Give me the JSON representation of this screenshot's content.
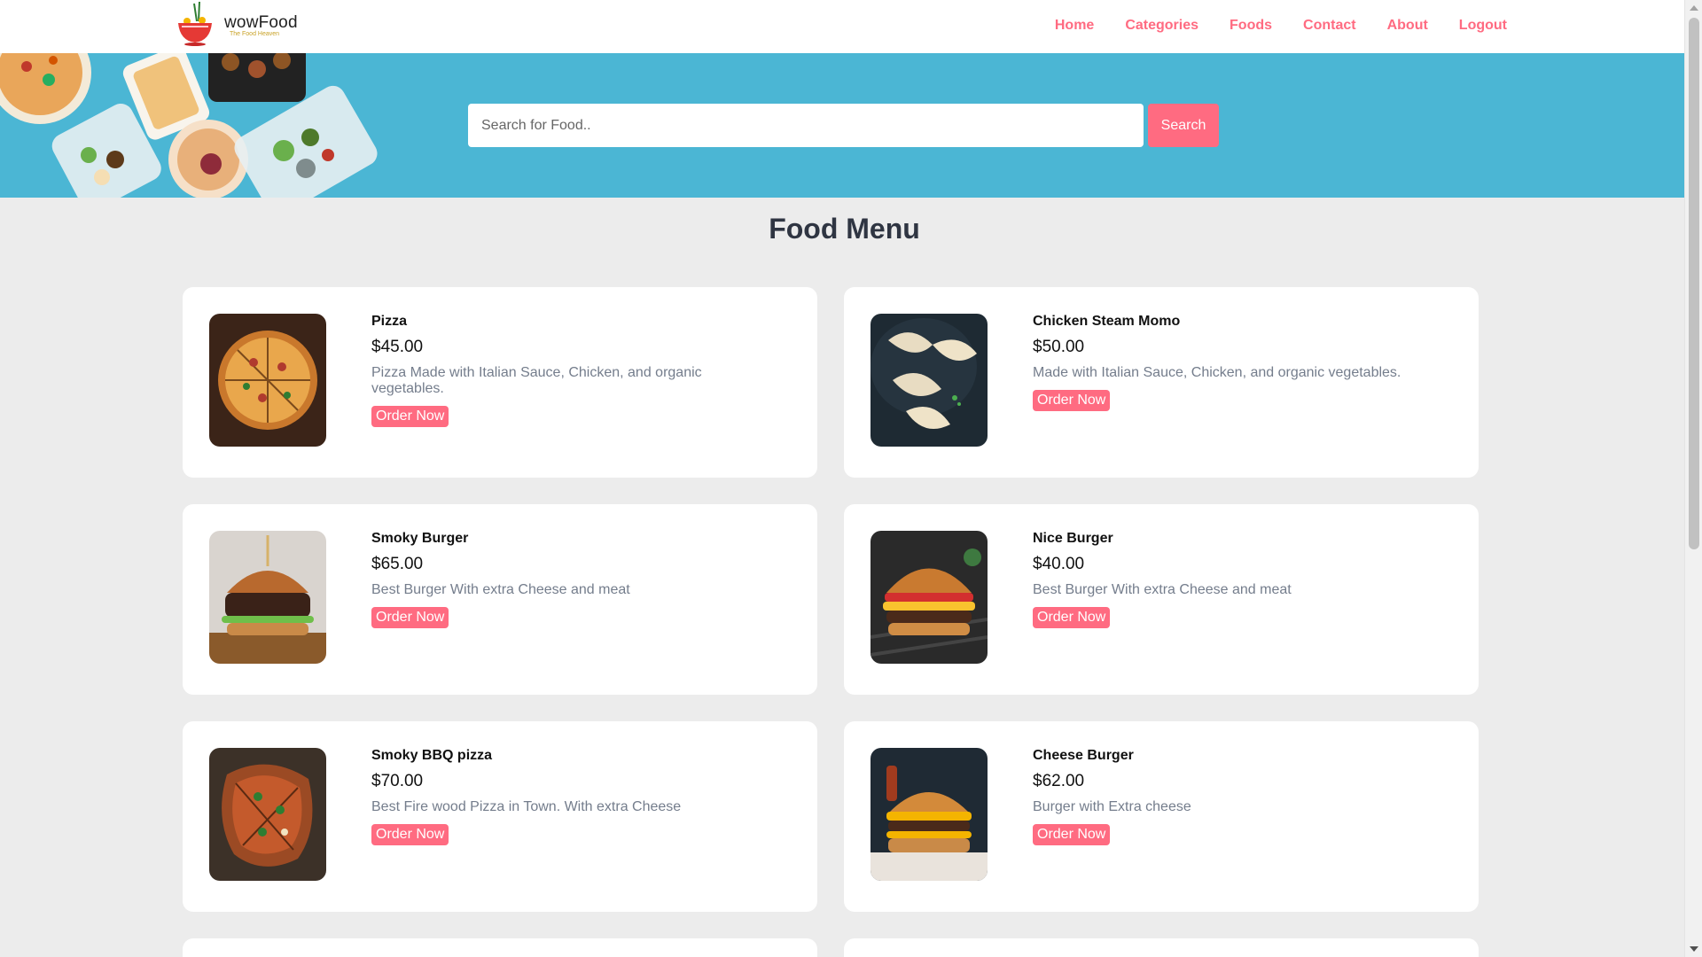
{
  "brand": {
    "name": "wowFood",
    "tagline": "The Food Heaven"
  },
  "nav": [
    "Home",
    "Categories",
    "Foods",
    "Contact",
    "About",
    "Logout"
  ],
  "search": {
    "placeholder": "Search for Food..",
    "button_label": "Search"
  },
  "menu": {
    "title": "Food Menu",
    "items": [
      {
        "name": "Pizza",
        "price": "$45.00",
        "description": "Pizza Made with Italian Sauce, Chicken, and organic vegetables.",
        "order_label": "Order Now",
        "image": "pizza"
      },
      {
        "name": "Chicken Steam Momo",
        "price": "$50.00",
        "description": "Made with Italian Sauce, Chicken, and organic vegetables.",
        "order_label": "Order Now",
        "image": "momo"
      },
      {
        "name": "Smoky Burger",
        "price": "$65.00",
        "description": "Best Burger With extra Cheese and meat",
        "order_label": "Order Now",
        "image": "burger"
      },
      {
        "name": "Nice Burger",
        "price": "$40.00",
        "description": "Best Burger With extra Cheese and meat",
        "order_label": "Order Now",
        "image": "burger"
      },
      {
        "name": "Smoky BBQ pizza",
        "price": "$70.00",
        "description": "Best Fire wood Pizza in Town. With extra Cheese",
        "order_label": "Order Now",
        "image": "pizza"
      },
      {
        "name": "Cheese Burger",
        "price": "$62.00",
        "description": "Burger with Extra cheese",
        "order_label": "Order Now",
        "image": "burger"
      }
    ]
  },
  "colors": {
    "accent": "#ff6b81",
    "hero": "#4bb6d4",
    "heading": "#2f3542",
    "muted": "#747d8c",
    "page_bg": "#ececec"
  }
}
